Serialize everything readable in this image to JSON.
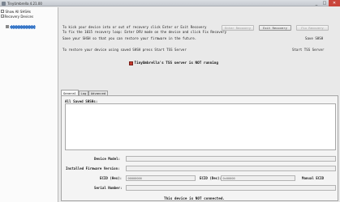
{
  "window": {
    "title": "TinyUmbrella 4.21.00",
    "minimize_glyph": "_",
    "maximize_glyph": "□",
    "close_glyph": "✕"
  },
  "sidebar": {
    "items": [
      {
        "label": "Show All SHSHs"
      },
      {
        "label": "Recovery Devices"
      }
    ]
  },
  "intro": {
    "line1": "To kick your device into or out of recovery click Enter or Exit Recovery",
    "line2": "To fix the 1015 recovery loop: Enter DFU mode on the device and click Fix Recovery",
    "line3": "Save your SHSH so that you can restore your firmware in the future.",
    "line4": "To restore your device using saved SHSH press Start TSS Server"
  },
  "toolbar": {
    "enter_recovery": "Enter Recovery",
    "exit_recovery": "Exit Recovery",
    "fix_recovery": "Fix Recovery",
    "save_shsh": "Save SHSH",
    "start_tss": "Start TSS Server"
  },
  "tss_status": "TinyUmbrella's TSS server is NOT running",
  "tabs": [
    {
      "label": "General"
    },
    {
      "label": "Log"
    },
    {
      "label": "Advanced"
    }
  ],
  "panel": {
    "saved_label": "All Saved SHSHs:"
  },
  "device": {
    "model_label": "Device Model:",
    "firmware_label": "Installed Firmware Version:",
    "ecid_hex_label": "ECID (Hex):",
    "ecid_hex_value": "00000000",
    "ecid_dec_label": "ECID (Dec):",
    "ecid_dec_value": "0x00000",
    "manual_ecid": "Manual ECID",
    "serial_label": "Serial Number:",
    "status": "This device is NOT connected."
  }
}
